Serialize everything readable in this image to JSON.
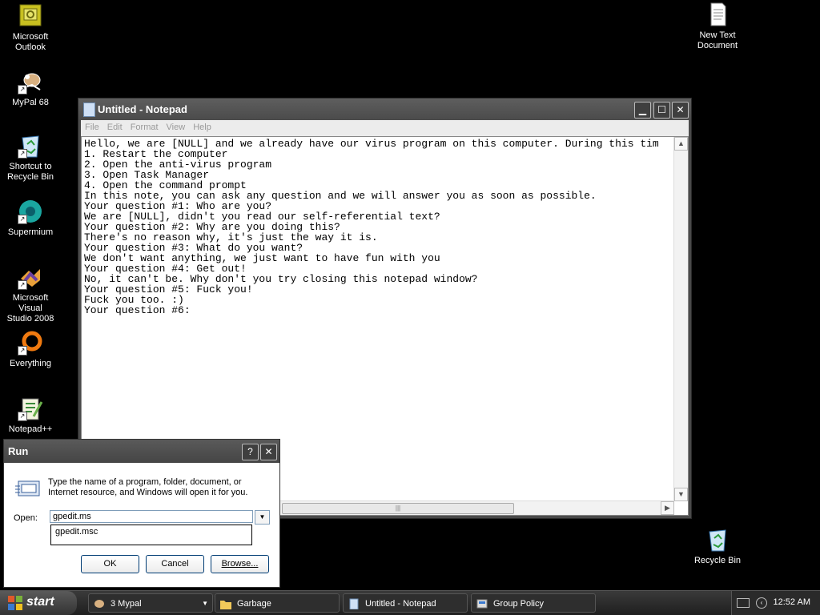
{
  "desktop": {
    "icons": [
      {
        "label": "Microsoft\nOutlook",
        "icon": "outlook-icon"
      },
      {
        "label": "MyPal 68",
        "icon": "mypal-icon"
      },
      {
        "label": "Shortcut to\nRecycle Bin",
        "icon": "recycle-bin-icon"
      },
      {
        "label": "Supermium",
        "icon": "supermium-icon"
      },
      {
        "label": "Microsoft Visual\nStudio 2008",
        "icon": "visual-studio-icon"
      },
      {
        "label": "Everything",
        "icon": "everything-icon"
      },
      {
        "label": "Notepad++",
        "icon": "notepadpp-icon"
      },
      {
        "label": "New Text\nDocument",
        "icon": "text-document-icon"
      },
      {
        "label": "Recycle Bin",
        "icon": "recycle-bin-icon"
      }
    ]
  },
  "notepad": {
    "title": "Untitled - Notepad",
    "menu": [
      "File",
      "Edit",
      "Format",
      "View",
      "Help"
    ],
    "content": "Hello, we are [NULL] and we already have our virus program on this computer. During this tim\n1. Restart the computer\n2. Open the anti-virus program\n3. Open Task Manager\n4. Open the command prompt\nIn this note, you can ask any question and we will answer you as soon as possible.\nYour question #1: Who are you?\nWe are [NULL], didn't you read our self-referential text?\nYour question #2: Why are you doing this?\nThere's no reason why, it's just the way it is.\nYour question #3: What do you want?\nWe don't want anything, we just want to have fun with you\nYour question #4: Get out!\nNo, it can't be. Why don't you try closing this notepad window?\nYour question #5: Fuck you!\nFuck you too. :)\nYour question #6:"
  },
  "run_dialog": {
    "title": "Run",
    "message": "Type the name of a program, folder, document, or Internet resource, and Windows will open it for you.",
    "open_label": "Open:",
    "input_value": "gpedit.ms",
    "suggestion": "gpedit.msc",
    "ok": "OK",
    "cancel": "Cancel",
    "browse": "Browse..."
  },
  "taskbar": {
    "start": "start",
    "tasks": [
      {
        "label": "3 Mypal",
        "icon": "mypal-icon"
      },
      {
        "label": "Garbage",
        "icon": "folder-icon"
      },
      {
        "label": "Untitled - Notepad",
        "icon": "notepad-icon"
      },
      {
        "label": "Group Policy",
        "icon": "group-policy-icon"
      }
    ],
    "clock": "12:52 AM"
  }
}
